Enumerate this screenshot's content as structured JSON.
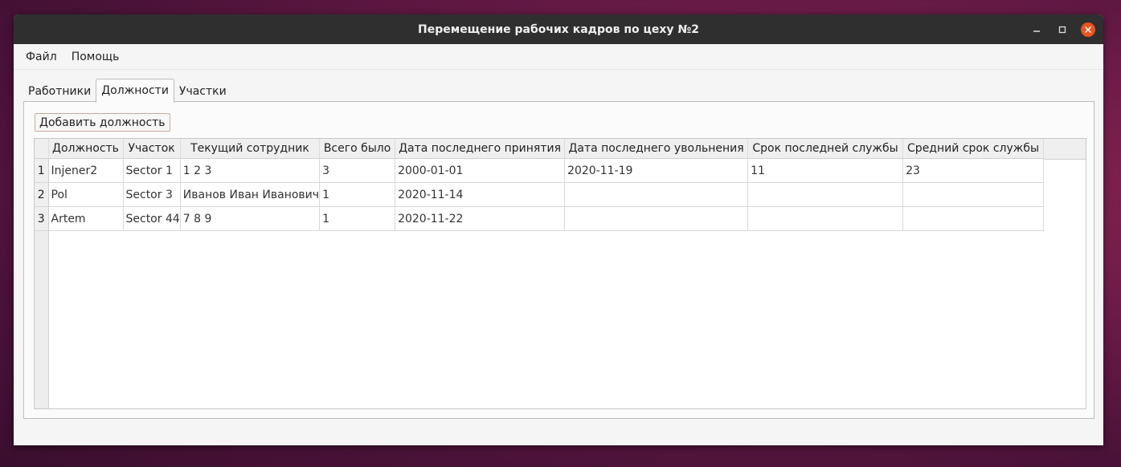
{
  "window": {
    "title": "Перемещение рабочих кадров по цеху №2"
  },
  "menu": [
    "Файл",
    "Помощь"
  ],
  "tabs": [
    {
      "label": "Работники",
      "active": false
    },
    {
      "label": "Должности",
      "active": true
    },
    {
      "label": "Участки",
      "active": false
    }
  ],
  "toolbar": {
    "add_label": "Добавить должность"
  },
  "table": {
    "columns": [
      "Должность",
      "Участок",
      "Текущий сотрудник",
      "Всего было",
      "Дата последнего принятия",
      "Дата последнего увольнения",
      "Срок последней службы",
      "Средний срок службы"
    ],
    "row_numbers": [
      "1",
      "2",
      "3"
    ],
    "rows": [
      [
        "Injener2",
        "Sector 1",
        "1 2 3",
        "3",
        "2000-01-01",
        "2020-11-19",
        "11",
        "23"
      ],
      [
        "Pol",
        "Sector 3",
        "Иванов Иван Иванович",
        "1",
        "2020-11-14",
        "",
        "",
        ""
      ],
      [
        "Artem",
        "Sector 44",
        "7 8 9",
        "1",
        "2020-11-22",
        "",
        "",
        ""
      ]
    ]
  },
  "icons": {
    "minimize": "minimize-icon",
    "maximize": "maximize-icon",
    "close": "close-icon"
  },
  "colors": {
    "close_button": "#e95420",
    "titlebar": "#2f2f2f"
  }
}
